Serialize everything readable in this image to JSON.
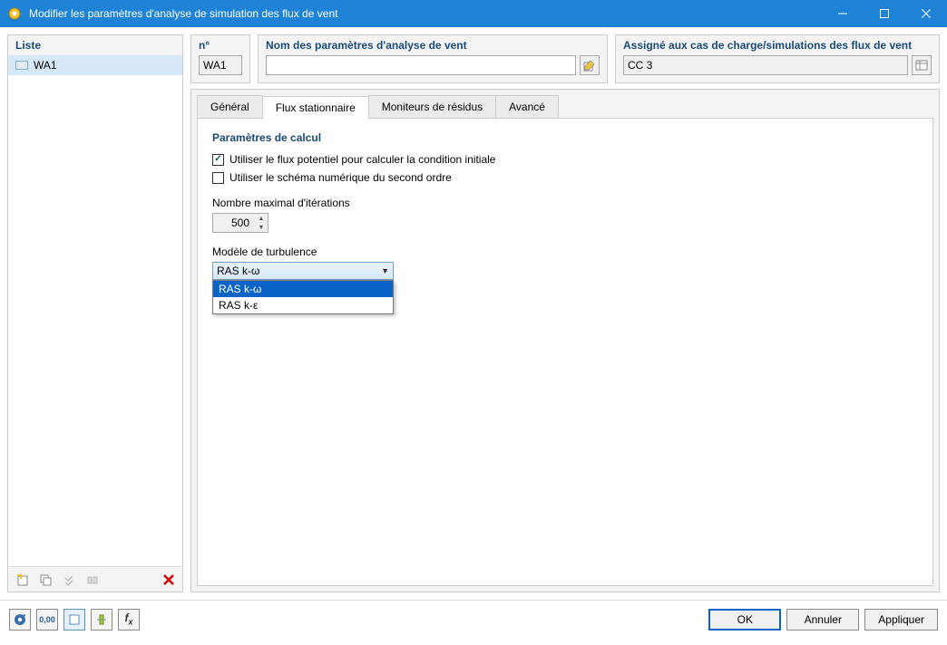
{
  "window": {
    "title": "Modifier les paramètres d'analyse de simulation des flux de vent"
  },
  "list": {
    "header": "Liste",
    "items": [
      {
        "label": "WA1"
      }
    ]
  },
  "topFields": {
    "n": {
      "label": "n°",
      "value": "WA1"
    },
    "name": {
      "label": "Nom des paramètres d'analyse de vent",
      "value": ""
    },
    "assigned": {
      "label": "Assigné aux cas de charge/simulations des flux de vent",
      "value": "CC 3"
    }
  },
  "tabs": {
    "items": [
      {
        "label": "Général"
      },
      {
        "label": "Flux stationnaire"
      },
      {
        "label": "Moniteurs de résidus"
      },
      {
        "label": "Avancé"
      }
    ],
    "activeIndex": 1
  },
  "content": {
    "sectionTitle": "Paramètres de calcul",
    "chk1": {
      "label": "Utiliser le flux potentiel pour calculer la condition initiale",
      "checked": true
    },
    "chk2": {
      "label": "Utiliser le schéma numérique du second ordre",
      "checked": false
    },
    "iterations": {
      "label": "Nombre maximal d'itérations",
      "value": "500"
    },
    "turbulence": {
      "label": "Modèle de turbulence",
      "value": "RAS k-ω",
      "options": [
        "RAS k-ω",
        "RAS k-ε"
      ],
      "selectedIndex": 0
    }
  },
  "buttons": {
    "ok": "OK",
    "cancel": "Annuler",
    "apply": "Appliquer"
  }
}
